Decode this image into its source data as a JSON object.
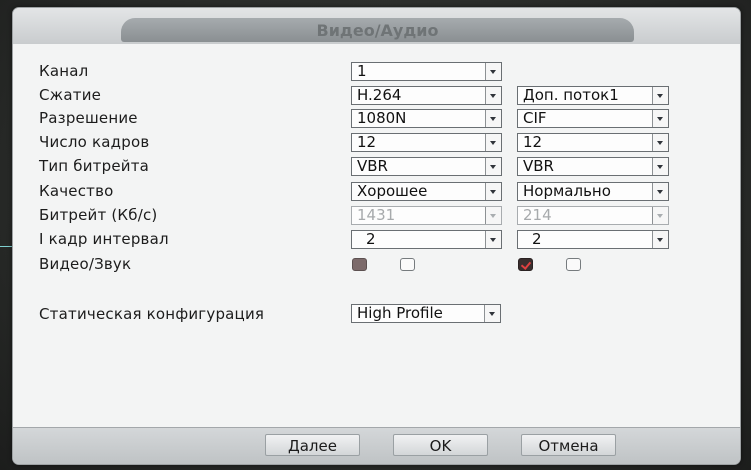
{
  "dialog": {
    "title": "Видео/Аудио"
  },
  "rows": [
    {
      "label": "Канал",
      "main": "1",
      "extra": null
    },
    {
      "label": "Сжатие",
      "main": "H.264",
      "extra": "Доп. поток1"
    },
    {
      "label": "Разрешение",
      "main": "1080N",
      "extra": "CIF"
    },
    {
      "label": "Число кадров",
      "main": "12",
      "extra": "12"
    },
    {
      "label": "Тип битрейта",
      "main": "VBR",
      "extra": "VBR"
    },
    {
      "label": "Качество",
      "main": "Хорошее",
      "extra": "Нормально"
    },
    {
      "label": "Битрейт (Кб/с)",
      "main": "1431",
      "extra": "214",
      "disabled": true
    },
    {
      "label": "I кадр интервал",
      "main": "2",
      "extra": "2"
    },
    {
      "label": "Видео/Звук",
      "checkboxes": {
        "main_video": true,
        "main_audio": false,
        "extra_video": true,
        "extra_audio": false
      }
    }
  ],
  "static_config": {
    "label": "Статическая конфигурация",
    "value": "High Profile"
  },
  "buttons": {
    "next": "Далее",
    "ok": "OK",
    "cancel": "Отмена"
  },
  "colors": {
    "checkbox_checked_mark": "#e04040",
    "title_tab": "#8a8f92"
  }
}
